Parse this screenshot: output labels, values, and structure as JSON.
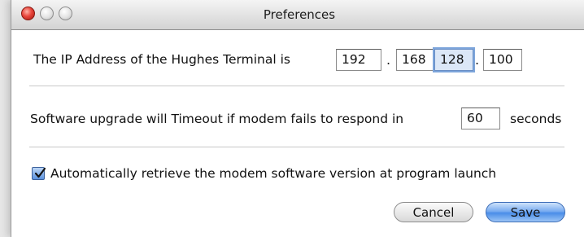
{
  "window": {
    "title": "Preferences"
  },
  "ip_section": {
    "label": "The IP Address of the Hughes Terminal is",
    "octets": [
      "192",
      "168",
      "128",
      "100"
    ],
    "separator": "."
  },
  "timeout_section": {
    "label_before": "Software upgrade will Timeout if modem fails to respond in",
    "value": "60",
    "label_after": "seconds"
  },
  "auto_retrieve": {
    "label": "Automatically retrieve the modem software version at program launch",
    "checked": true
  },
  "buttons": {
    "cancel": "Cancel",
    "save": "Save"
  },
  "colors": {
    "accent": "#4a8de8",
    "focus_field": "#dbe7f7",
    "close_button": "#e8453b"
  }
}
